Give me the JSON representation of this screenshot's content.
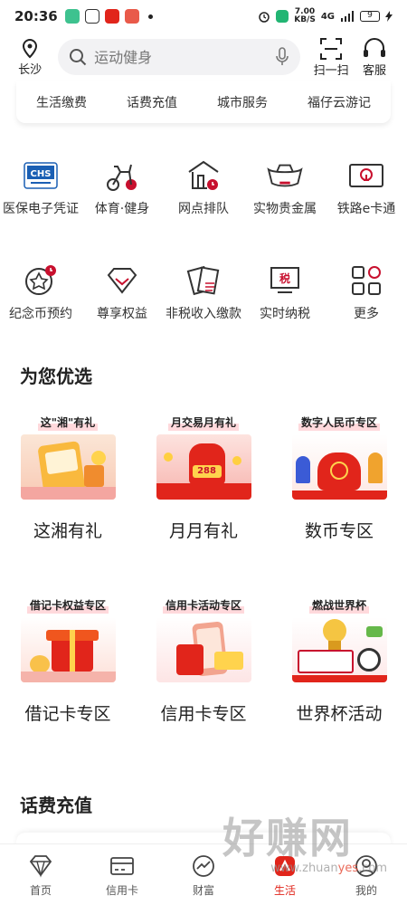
{
  "status": {
    "time": "20:36",
    "net_speed": "7.00",
    "net_unit": "KB/S",
    "signal": "4G",
    "battery": "9"
  },
  "header": {
    "location": "长沙",
    "search_placeholder": "运动健身",
    "scan_label": "扫一扫",
    "service_label": "客服"
  },
  "top_services": [
    "生活缴费",
    "话费充值",
    "城市服务",
    "福仔云游记"
  ],
  "grid_row1": [
    "医保电子凭证",
    "体育·健身",
    "网点排队",
    "实物贵金属",
    "铁路e卡通"
  ],
  "grid_row2": [
    "纪念币预约",
    "尊享权益",
    "非税收入缴款",
    "实时纳税",
    "更多"
  ],
  "grid_icons": {
    "chs": "CHS",
    "tax": "税"
  },
  "section_title": "为您优选",
  "promos_row1": [
    {
      "tag": "这\"湘\"有礼",
      "name": "这湘有礼"
    },
    {
      "tag": "月交易月有礼",
      "name": "月月有礼"
    },
    {
      "tag": "数字人民币专区",
      "name": "数币专区"
    }
  ],
  "promos_row2": [
    {
      "tag": "借记卡权益专区",
      "name": "借记卡专区"
    },
    {
      "tag": "信用卡活动专区",
      "name": "信用卡专区"
    },
    {
      "tag": "燃战世界杯",
      "name": "世界杯活动"
    }
  ],
  "promo_art_text": {
    "amount": "288"
  },
  "recharge_title": "话费充值",
  "bottom_nav": [
    "首页",
    "信用卡",
    "财富",
    "生活",
    "我的"
  ],
  "active_nav": "生活",
  "watermark": {
    "text": "好赚网",
    "url_pre": "www.zhuan",
    "url_y": "yes",
    "url_post": ".com"
  },
  "colors": {
    "accent": "#e1251b",
    "icon_red": "#c8102e"
  }
}
